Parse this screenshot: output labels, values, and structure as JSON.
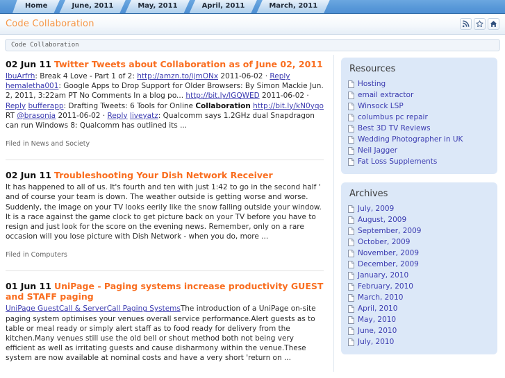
{
  "tabs": [
    {
      "label": "Home"
    },
    {
      "label": "June, 2011"
    },
    {
      "label": "May, 2011"
    },
    {
      "label": "April, 2011"
    },
    {
      "label": "March, 2011"
    }
  ],
  "header": {
    "site_title": "Code Collaboration",
    "tools": [
      {
        "name": "rss-icon",
        "title": "RSS"
      },
      {
        "name": "star-icon",
        "title": "Favorite"
      },
      {
        "name": "home-icon",
        "title": "Home"
      }
    ]
  },
  "breadcrumb": {
    "text": "Code Collaboration"
  },
  "posts": [
    {
      "date": "02 Jun 11",
      "title": "Twitter Tweets about Collaboration as of June 02, 2011",
      "body_segments": [
        {
          "type": "link",
          "text": "IbuArfrh"
        },
        {
          "type": "text",
          "text": ": Break 4 Love - Part 1 of 2: "
        },
        {
          "type": "link",
          "text": "http://amzn.to/ijmONx"
        },
        {
          "type": "text",
          "text": " 2011-06-02 · "
        },
        {
          "type": "link",
          "text": "Reply"
        },
        {
          "type": "text",
          "text": " "
        },
        {
          "type": "link",
          "text": "hemaletha001"
        },
        {
          "type": "text",
          "text": ": Google Apps to Drop Support for Older Browsers: By Simon Mackie Jun. 2, 2011, 3:22am PT No Comments In a blog po... "
        },
        {
          "type": "link",
          "text": "http://bit.ly/lGQWED"
        },
        {
          "type": "text",
          "text": " 2011-06-02 · "
        },
        {
          "type": "link",
          "text": "Reply"
        },
        {
          "type": "text",
          "text": " "
        },
        {
          "type": "link",
          "text": "bufferapp"
        },
        {
          "type": "text",
          "text": ": Drafting Tweets: 6 Tools for Online "
        },
        {
          "type": "bold",
          "text": "Collaboration"
        },
        {
          "type": "text",
          "text": " "
        },
        {
          "type": "link",
          "text": "http://bit.ly/kN0yqo"
        },
        {
          "type": "text",
          "text": " RT "
        },
        {
          "type": "link",
          "text": "@brasonja"
        },
        {
          "type": "text",
          "text": " 2011-06-02 · "
        },
        {
          "type": "link",
          "text": "Reply"
        },
        {
          "type": "text",
          "text": " "
        },
        {
          "type": "link",
          "text": "liveyatz"
        },
        {
          "type": "text",
          "text": ": Qualcomm says 1.2GHz dual Snapdragon can run Windows 8: Qualcomm has outlined its ..."
        }
      ],
      "filed": "Filed in News and Society"
    },
    {
      "date": "02 Jun 11",
      "title": "Troubleshooting Your Dish Network Receiver",
      "body_segments": [
        {
          "type": "text",
          "text": "It has happened to all of us. It's fourth and ten with just 1:42 to go in the second half ' and of course your team is down. The weather outside is getting worse and worse. Suddenly, the image on your TV looks eerily like the snow falling outside your window. It is a race against the game clock to get picture back on your TV before you have to resign and just look for the score on the evening news. Remember, only on a rare occasion will you lose picture with Dish Network - when you do, more ..."
        }
      ],
      "filed": "Filed in Computers"
    },
    {
      "date": "01 Jun 11",
      "title": "UniPage - Paging systems increase productivity GUEST and STAFF paging",
      "body_segments": [
        {
          "type": "link",
          "text": "UniPage GuestCall & ServerCall Paging Systems"
        },
        {
          "type": "text",
          "text": "The introduction of a UniPage on-site paging system optimises your venues overall service performance.Alert guests as to table or meal ready or simply alert staff as to food ready for delivery from the kitchen.Many venues still use the old bell or shout method both not being very efficient as well as irritating guests and cause disharmony within the venue.These system are now available at nominal costs and have a very short 'return on ..."
        }
      ],
      "filed": ""
    }
  ],
  "sidebar": {
    "widgets": [
      {
        "title": "Resources",
        "items": [
          {
            "label": "Hosting"
          },
          {
            "label": "email extractor"
          },
          {
            "label": "Winsock LSP"
          },
          {
            "label": "columbus pc repair"
          },
          {
            "label": "Best 3D TV Reviews"
          },
          {
            "label": "Wedding Photographer in UK"
          },
          {
            "label": "Neil Jagger"
          },
          {
            "label": "Fat Loss Supplements"
          }
        ]
      },
      {
        "title": "Archives",
        "items": [
          {
            "label": "July, 2009"
          },
          {
            "label": "August, 2009"
          },
          {
            "label": "September, 2009"
          },
          {
            "label": "October, 2009"
          },
          {
            "label": "November, 2009"
          },
          {
            "label": "December, 2009"
          },
          {
            "label": "January, 2010"
          },
          {
            "label": "February, 2010"
          },
          {
            "label": "March, 2010"
          },
          {
            "label": "April, 2010"
          },
          {
            "label": "May, 2010"
          },
          {
            "label": "June, 2010"
          },
          {
            "label": "July, 2010"
          }
        ]
      }
    ]
  },
  "colors": {
    "accent_orange": "#f96e20",
    "title_orange": "#f79646",
    "link_blue": "#3b3bb0",
    "tabbar_blue": "#5a9ad9",
    "widget_bg": "#dce8f8"
  }
}
